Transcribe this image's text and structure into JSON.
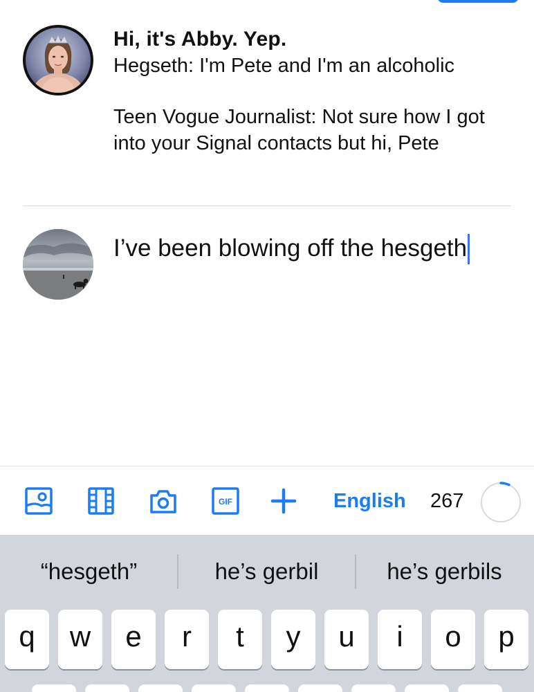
{
  "quoted_post": {
    "title": "Hi, it's Abby. Yep.",
    "line1": "Hegseth: I'm Pete and I'm an alcoholic",
    "line2": "Teen Vogue Journalist: Not sure how I got into your Signal contacts but hi, Pete"
  },
  "compose": {
    "text": "I’ve been blowing off the hesgeth"
  },
  "toolbar": {
    "icons": [
      "image-icon",
      "video-icon",
      "camera-icon",
      "gif-icon",
      "add-icon"
    ],
    "gif_label": "GIF",
    "language": "English",
    "char_count": "267",
    "char_progress": 0.07,
    "accent": "#1d7cf2"
  },
  "keyboard": {
    "suggestions": [
      "“hesgeth”",
      "he’s gerbil",
      "he’s gerbils"
    ],
    "top_row": [
      "q",
      "w",
      "e",
      "r",
      "t",
      "y",
      "u",
      "i",
      "o",
      "p"
    ]
  }
}
